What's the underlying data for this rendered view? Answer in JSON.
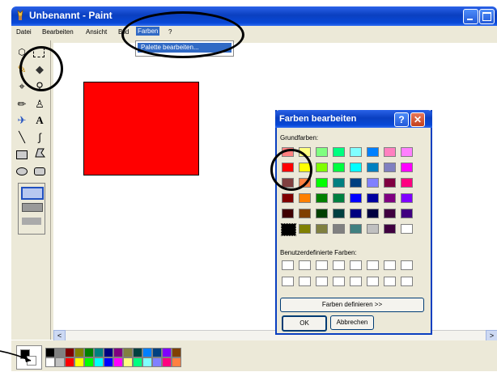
{
  "window": {
    "title": "Unbenannt - Paint"
  },
  "menu": {
    "items": [
      "Datei",
      "Bearbeiten",
      "Ansicht",
      "Bild",
      "Farben",
      "?"
    ],
    "active": "Farben",
    "dropdown_item": "Palette bearbeiten..."
  },
  "dialog": {
    "title": "Farben bearbeiten",
    "help": "?",
    "close": "✕",
    "basic_label": "Grundfarben:",
    "custom_label": "Benutzerdefinierte Farben:",
    "define_button": "Farben definieren >>",
    "ok_button": "OK",
    "cancel_button": "Abbrechen",
    "basic_colors": [
      [
        "#ff8080",
        "#ffff80",
        "#80ff80",
        "#00ff80",
        "#80ffff",
        "#0080ff",
        "#ff80c0",
        "#ff80ff"
      ],
      [
        "#ff0000",
        "#ffff00",
        "#80ff00",
        "#00ff40",
        "#00ffff",
        "#0080c0",
        "#8080c0",
        "#ff00ff"
      ],
      [
        "#804040",
        "#ff8040",
        "#00ff00",
        "#008080",
        "#004080",
        "#8080ff",
        "#800040",
        "#ff0080"
      ],
      [
        "#800000",
        "#ff8000",
        "#008000",
        "#008040",
        "#0000ff",
        "#0000a0",
        "#800080",
        "#8000ff"
      ],
      [
        "#400000",
        "#804000",
        "#004000",
        "#004040",
        "#000080",
        "#000040",
        "#400040",
        "#400080"
      ],
      [
        "#000000",
        "#808000",
        "#808040",
        "#808080",
        "#408080",
        "#c0c0c0",
        "#400040",
        "#ffffff"
      ]
    ]
  },
  "palette": {
    "top": [
      "#000000",
      "#808080",
      "#800000",
      "#808000",
      "#008000",
      "#008080",
      "#000080",
      "#800080",
      "#808040",
      "#004040",
      "#0080ff",
      "#004080",
      "#8000ff",
      "#804000"
    ],
    "bottom": [
      "#ffffff",
      "#c0c0c0",
      "#ff0000",
      "#ffff00",
      "#00ff00",
      "#00ffff",
      "#0000ff",
      "#ff00ff",
      "#ffff80",
      "#00ff80",
      "#80ffff",
      "#8080ff",
      "#ff0080",
      "#ff8040"
    ]
  },
  "scroll": {
    "left": "<",
    "right": ">"
  },
  "tools": {
    "pencil": "✎",
    "fill": "◆",
    "picker": "⌖",
    "magnifier": "⚲",
    "pen": "✏",
    "brush": "♙",
    "airbrush": "✈",
    "text": "A",
    "line": "╲",
    "curve": "∫"
  }
}
